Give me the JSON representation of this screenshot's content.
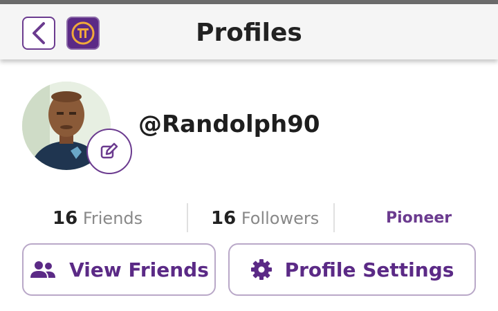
{
  "header": {
    "title": "Profiles",
    "back_icon": "chevron-left-icon",
    "logo_icon": "pi-logo-icon"
  },
  "profile": {
    "username": "@Randolph90",
    "avatar": "avatar",
    "edit_icon": "pencil-icon"
  },
  "stats": {
    "friends_count": "16",
    "friends_label": "Friends",
    "followers_count": "16",
    "followers_label": "Followers",
    "role": "Pioneer"
  },
  "actions": {
    "view_friends_label": "View Friends",
    "profile_settings_label": "Profile Settings"
  },
  "colors": {
    "accent": "#5b2a86",
    "logo_gold": "#f0a93a"
  }
}
